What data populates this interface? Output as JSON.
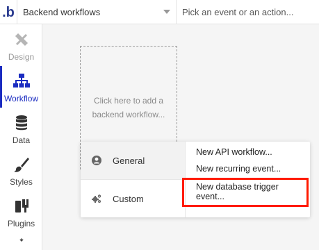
{
  "header": {
    "logo": ".b",
    "workflows_dropdown": "Backend workflows",
    "events_dropdown": "Pick an event or an action..."
  },
  "sidebar": {
    "items": [
      {
        "label": "Design"
      },
      {
        "label": "Workflow"
      },
      {
        "label": "Data"
      },
      {
        "label": "Styles"
      },
      {
        "label": "Plugins"
      }
    ]
  },
  "canvas": {
    "placeholder": "Click here to add a backend workflow..."
  },
  "menu": {
    "categories": [
      {
        "label": "General",
        "icon": "user-icon"
      },
      {
        "label": "Custom",
        "icon": "gears-icon"
      }
    ],
    "options": [
      {
        "label": "New API workflow..."
      },
      {
        "label": "New recurring event..."
      },
      {
        "label_line1": "New database trigger",
        "label_line2": "event..."
      }
    ]
  },
  "colors": {
    "accent": "#1b2cc1",
    "highlight": "#ff1a00"
  }
}
